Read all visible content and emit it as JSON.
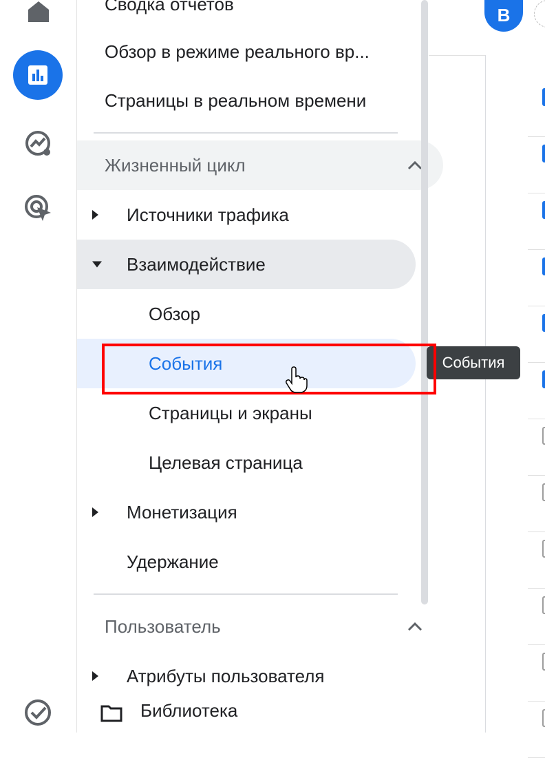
{
  "nav": {
    "top_items": [
      {
        "label": "Сводка отчетов"
      },
      {
        "label": "Обзор в режиме реального вр..."
      },
      {
        "label": "Страницы в реальном времени"
      }
    ],
    "sections": [
      {
        "title": "Жизненный цикл",
        "items": [
          {
            "label": "Источники трафика",
            "expandable": true,
            "expanded": false
          },
          {
            "label": "Взаимодействие",
            "expandable": true,
            "expanded": true,
            "children": [
              {
                "label": "Обзор"
              },
              {
                "label": "События",
                "selected": true
              },
              {
                "label": "Страницы и экраны"
              },
              {
                "label": "Целевая страница"
              }
            ]
          },
          {
            "label": "Монетизация",
            "expandable": true,
            "expanded": false
          },
          {
            "label": "Удержание"
          }
        ]
      },
      {
        "title": "Пользователь",
        "items": [
          {
            "label": "Атрибуты пользователя",
            "expandable": true
          }
        ]
      }
    ],
    "library_label": "Библиотека"
  },
  "tooltip": "События",
  "account": {
    "avatar_letter": "B"
  },
  "colors": {
    "accent": "#1a73e8",
    "selected_bg": "#e8f0fe",
    "highlight": "#ff0000",
    "tooltip_bg": "#3c4043"
  },
  "icons": [
    "home-icon",
    "reports-icon",
    "explore-icon",
    "advertising-icon",
    "admin-check-icon",
    "folder-icon"
  ]
}
